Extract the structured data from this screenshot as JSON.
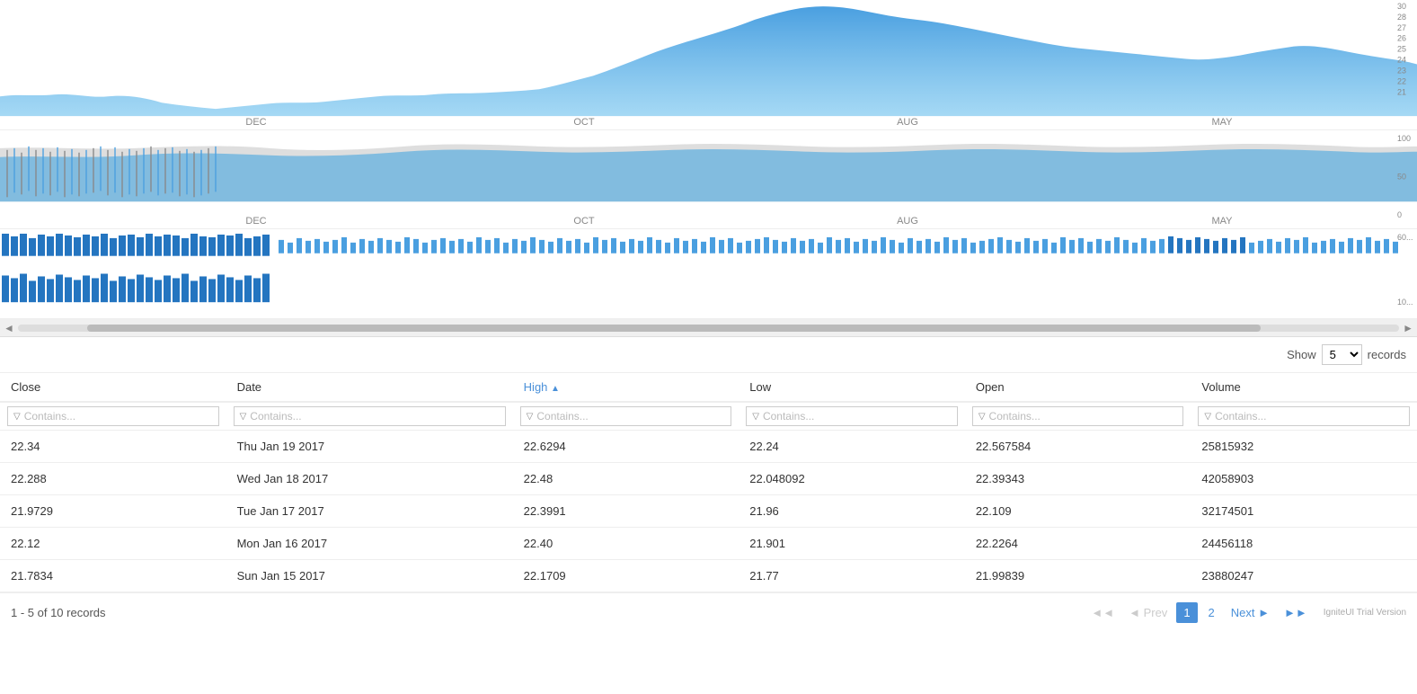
{
  "charts": {
    "chart1": {
      "yaxis": [
        "30",
        "28",
        "27",
        "26",
        "25",
        "24",
        "23",
        "22",
        "21"
      ],
      "xaxis": [
        "DEC",
        "OCT",
        "AUG",
        "MAY"
      ]
    },
    "chart2": {
      "yaxis": [
        "100",
        "50",
        "0"
      ],
      "xaxis": [
        "DEC",
        "OCT",
        "AUG",
        "MAY"
      ]
    },
    "chart3": {
      "yaxis": [
        "60...",
        "10..."
      ]
    }
  },
  "tableControls": {
    "showLabel": "Show",
    "recordsValue": "5",
    "recordsLabel": "records"
  },
  "columns": [
    {
      "key": "close",
      "label": "Close",
      "active": false
    },
    {
      "key": "date",
      "label": "Date",
      "active": false
    },
    {
      "key": "high",
      "label": "High",
      "active": true
    },
    {
      "key": "low",
      "label": "Low",
      "active": false
    },
    {
      "key": "open",
      "label": "Open",
      "active": false
    },
    {
      "key": "volume",
      "label": "Volume",
      "active": false
    }
  ],
  "filterPlaceholder": "Contains...",
  "rows": [
    {
      "close": "22.34",
      "date": "Thu Jan 19 2017",
      "high": "22.6294",
      "low": "22.24",
      "open": "22.567584",
      "volume": "25815932"
    },
    {
      "close": "22.288",
      "date": "Wed Jan 18 2017",
      "high": "22.48",
      "low": "22.048092",
      "open": "22.39343",
      "volume": "42058903"
    },
    {
      "close": "21.9729",
      "date": "Tue Jan 17 2017",
      "high": "22.3991",
      "low": "21.96",
      "open": "22.109",
      "volume": "32174501"
    },
    {
      "close": "22.12",
      "date": "Mon Jan 16 2017",
      "high": "22.40",
      "low": "21.901",
      "open": "22.2264",
      "volume": "24456118"
    },
    {
      "close": "21.7834",
      "date": "Sun Jan 15 2017",
      "high": "22.1709",
      "low": "21.77",
      "open": "21.99839",
      "volume": "23880247"
    }
  ],
  "pagination": {
    "info": "1 - 5 of 10 records",
    "prevLabel": "◄ Prev",
    "nextLabel": "Next ►",
    "currentPage": "1",
    "page2": "2",
    "watermark": "IgniteUI Trial Version"
  }
}
